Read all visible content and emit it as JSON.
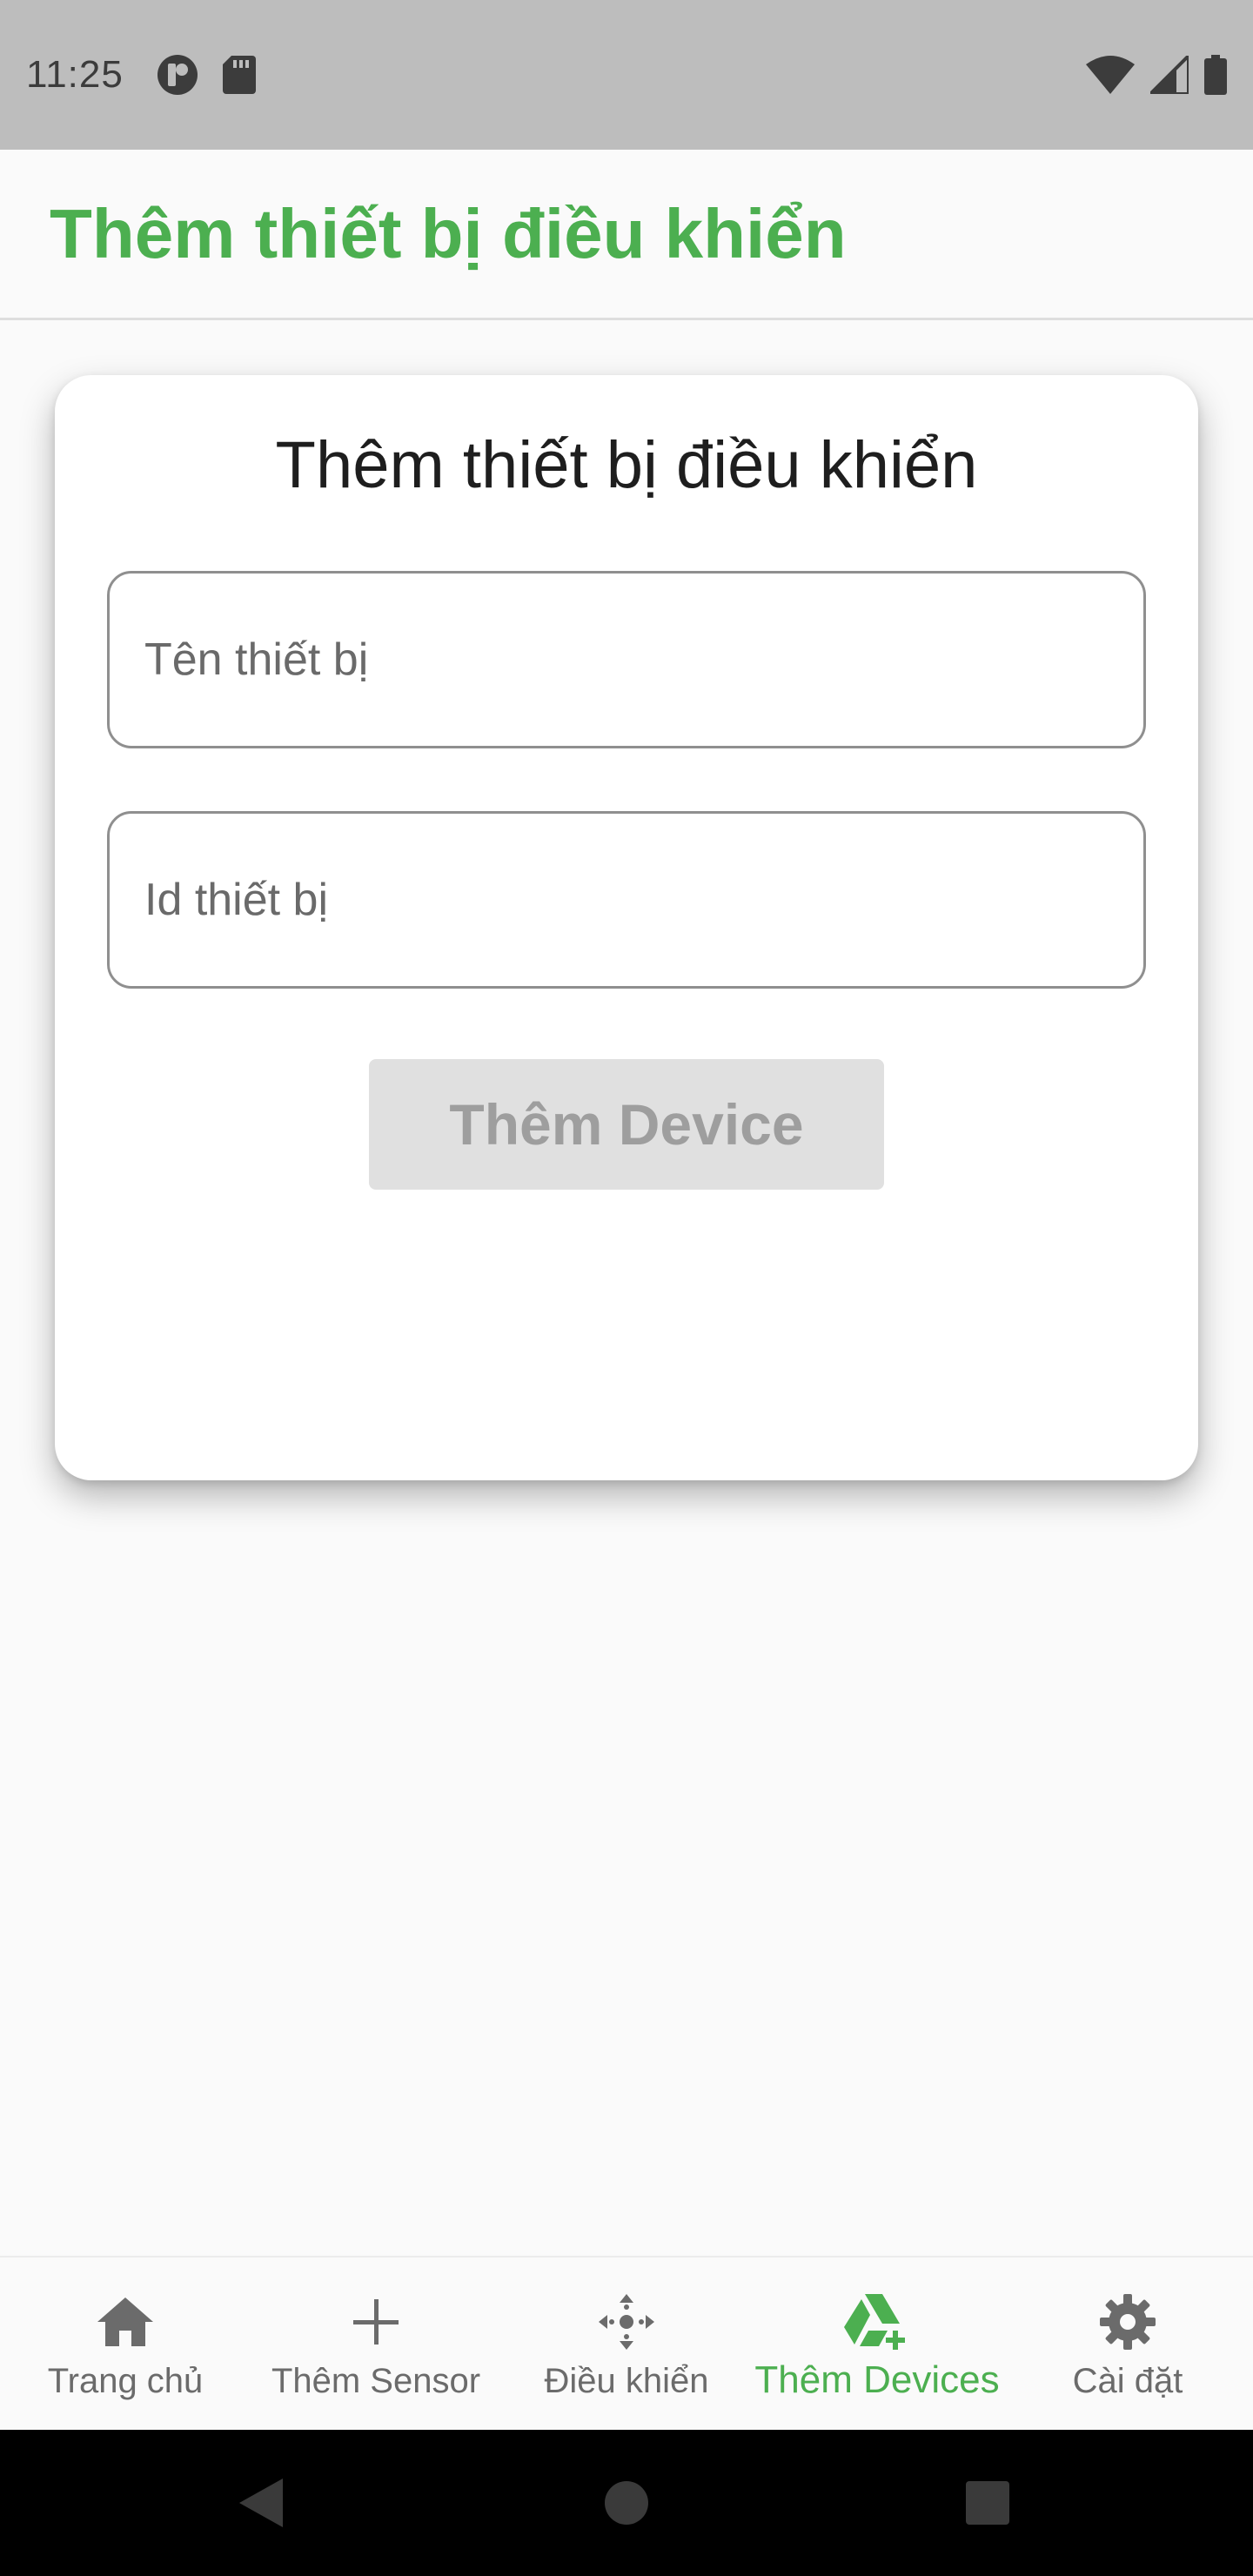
{
  "status_bar": {
    "time": "11:25",
    "left_icons": [
      "notification-app-icon",
      "sd-card-icon"
    ],
    "right_icons": [
      "wifi-icon",
      "cell-signal-icon",
      "battery-icon"
    ]
  },
  "app_bar": {
    "title": "Thêm thiết bị điều khiển",
    "title_color": "#4caf50"
  },
  "card": {
    "title": "Thêm thiết bị điều khiển",
    "name_field": {
      "placeholder": "Tên thiết bị",
      "value": ""
    },
    "id_field": {
      "placeholder": "Id thiết bị",
      "value": ""
    },
    "submit_label": "Thêm Device",
    "submit_enabled": false
  },
  "bottom_nav": {
    "active_index": 3,
    "active_color": "#4caf50",
    "items": [
      {
        "label": "Trang chủ",
        "icon": "home-icon"
      },
      {
        "label": "Thêm Sensor",
        "icon": "plus-icon"
      },
      {
        "label": "Điều khiển",
        "icon": "control-pad-icon"
      },
      {
        "label": "Thêm Devices",
        "icon": "add-device-icon"
      },
      {
        "label": "Cài đặt",
        "icon": "gear-icon"
      }
    ]
  },
  "system_nav": {
    "buttons": [
      "back-icon",
      "home-circle-icon",
      "recents-square-icon"
    ]
  }
}
